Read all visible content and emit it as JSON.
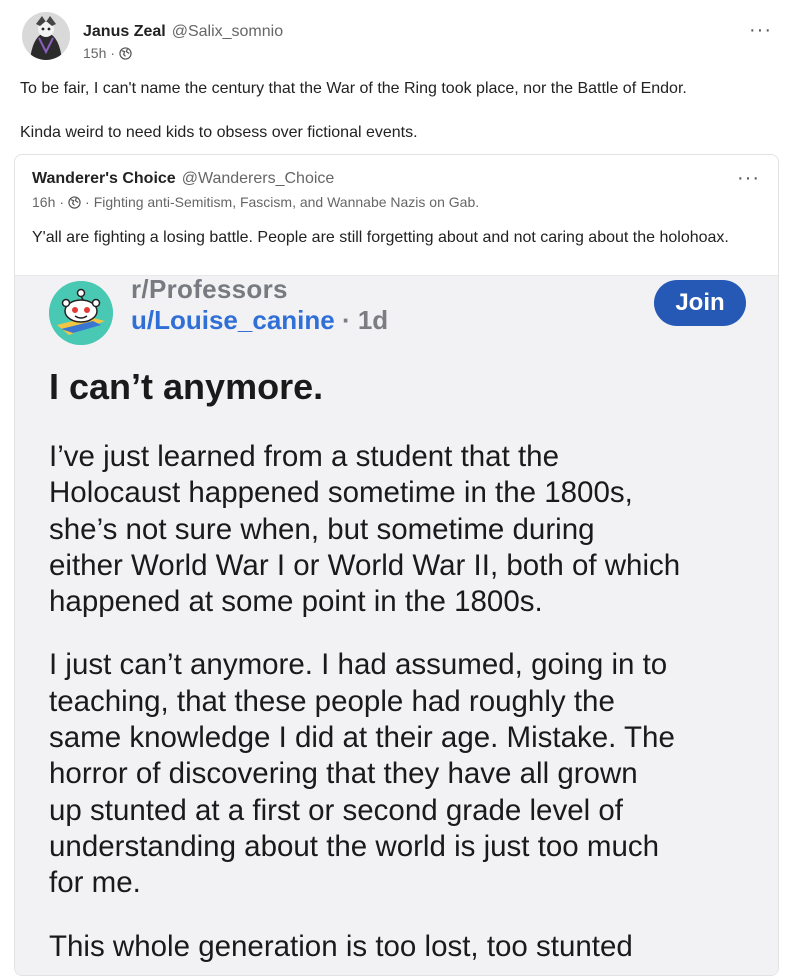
{
  "post": {
    "author_name": "Janus Zeal",
    "author_handle": "@Salix_somnio",
    "time": "15h",
    "paragraphs": [
      "To be fair, I can't name the century that the War of the Ring took place, nor the Battle of Endor.",
      "Kinda weird to need kids to obsess over fictional events."
    ],
    "more_icon": "···"
  },
  "quote": {
    "author_name": "Wanderer's Choice",
    "author_handle": "@Wanderers_Choice",
    "time": "16h",
    "bio": "Fighting anti-Semitism, Fascism, and Wannabe Nazis on Gab.",
    "text": "Y'all are fighting a losing battle. People are still forgetting about and not caring about the holohoax.",
    "more_icon": "···"
  },
  "embed": {
    "subreddit": "r/Professors",
    "user": "u/Louise_canine",
    "age": "· 1d",
    "join_label": "Join",
    "title": "I can’t anymore.",
    "paragraphs": [
      "I’ve just learned from a student that the\nHolocaust happened sometime in the 1800s,\nshe’s not sure when, but sometime during\neither World War I or World War II, both of which\nhappened at some point in the 1800s.",
      "I just can’t anymore. I had assumed, going in to\nteaching, that these people had roughly the\nsame knowledge I did at their age. Mistake. The\nhorror of discovering that they have all grown\nup stunted at a first or second grade level of\nunderstanding about the world is just too much\nfor me.",
      "This whole generation is too lost, too stunted"
    ]
  },
  "colors": {
    "accent_blue": "#2659b5",
    "reddit_teal": "#49c9b4",
    "username_blue": "#2f6fd6"
  },
  "icons": [
    "globe-icon",
    "more-options-icon",
    "reddit-snoo-icon"
  ]
}
